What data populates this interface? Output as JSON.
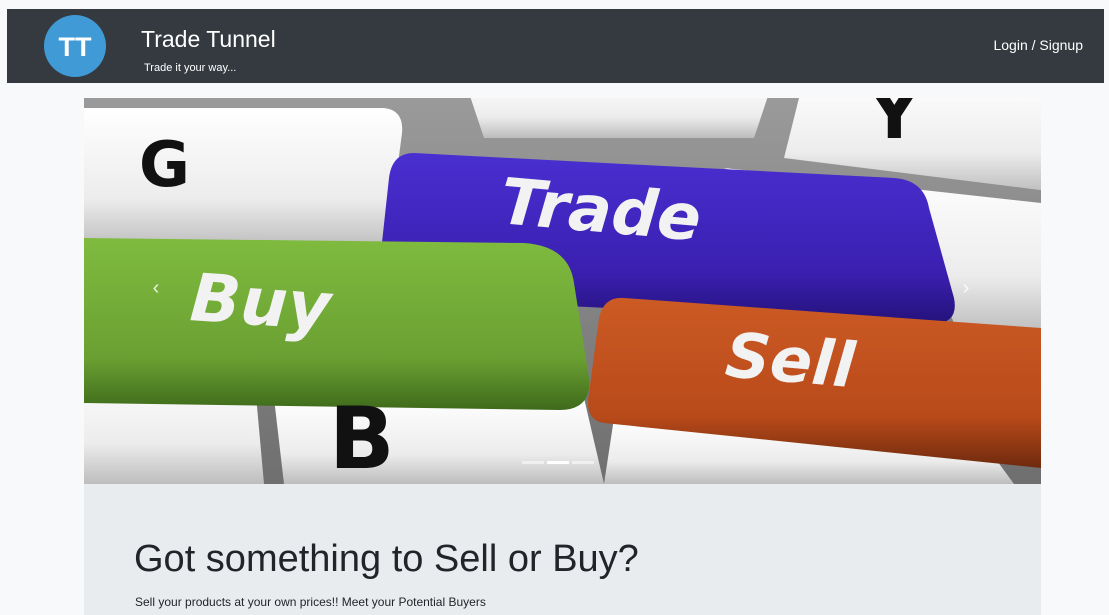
{
  "header": {
    "logo_initials": "TT",
    "brand": "Trade Tunnel",
    "tagline": "Trade it your way...",
    "login_label": "Login / Signup"
  },
  "carousel": {
    "keys": {
      "trade": "Trade",
      "buy": "Buy",
      "sell": "Sell",
      "g": "G",
      "b": "B",
      "y": "Y"
    },
    "prev_icon": "chevron-left-icon",
    "next_icon": "chevron-right-icon",
    "slide_count": 3,
    "active_slide": 2
  },
  "hero": {
    "headline": "Got something to Sell or Buy?",
    "lead": "Sell your products at your own prices!! Meet your Potential Buyers"
  },
  "colors": {
    "navbar": "#343a40",
    "logo": "#3f9ad6",
    "trade_key": "#3a1fb0",
    "buy_key": "#6aa032",
    "sell_key": "#b84a1a",
    "jumbotron": "#e9ecef"
  }
}
